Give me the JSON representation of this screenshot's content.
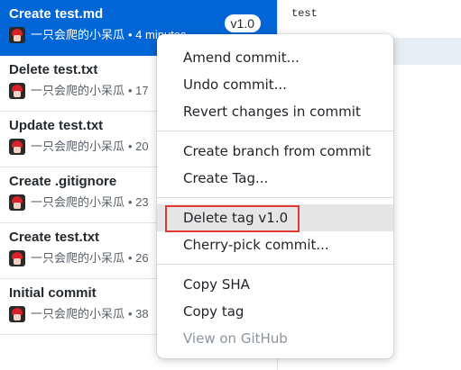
{
  "commits": [
    {
      "title": "Create test.md",
      "author": "一只会爬的小呆瓜",
      "time": "• 4 minutes",
      "tag": "v1.0",
      "selected": true
    },
    {
      "title": "Delete test.txt",
      "author": "一只会爬的小呆瓜",
      "time": "• 17",
      "tag": null,
      "selected": false
    },
    {
      "title": "Update test.txt",
      "author": "一只会爬的小呆瓜",
      "time": "• 20",
      "tag": null,
      "selected": false
    },
    {
      "title": "Create .gitignore",
      "author": "一只会爬的小呆瓜",
      "time": "• 23",
      "tag": null,
      "selected": false
    },
    {
      "title": "Create test.txt",
      "author": "一只会爬的小呆瓜",
      "time": "• 26",
      "tag": null,
      "selected": false
    },
    {
      "title": "Initial commit",
      "author": "一只会爬的小呆瓜",
      "time": "• 38",
      "tag": null,
      "selected": false
    }
  ],
  "file_view": {
    "content": "test"
  },
  "context_menu": {
    "amend_commit": "Amend commit...",
    "undo_commit": "Undo commit...",
    "revert_changes": "Revert changes in commit",
    "create_branch": "Create branch from commit",
    "create_tag": "Create Tag...",
    "delete_tag": "Delete tag v1.0",
    "cherry_pick": "Cherry-pick commit...",
    "copy_sha": "Copy SHA",
    "copy_tag": "Copy tag",
    "view_on_github": "View on GitHub"
  },
  "colors": {
    "selected_row": "#0366d6",
    "highlight_border": "#e53935",
    "menu_hover": "#e6e6e6",
    "disabled_text": "#8c959f"
  }
}
